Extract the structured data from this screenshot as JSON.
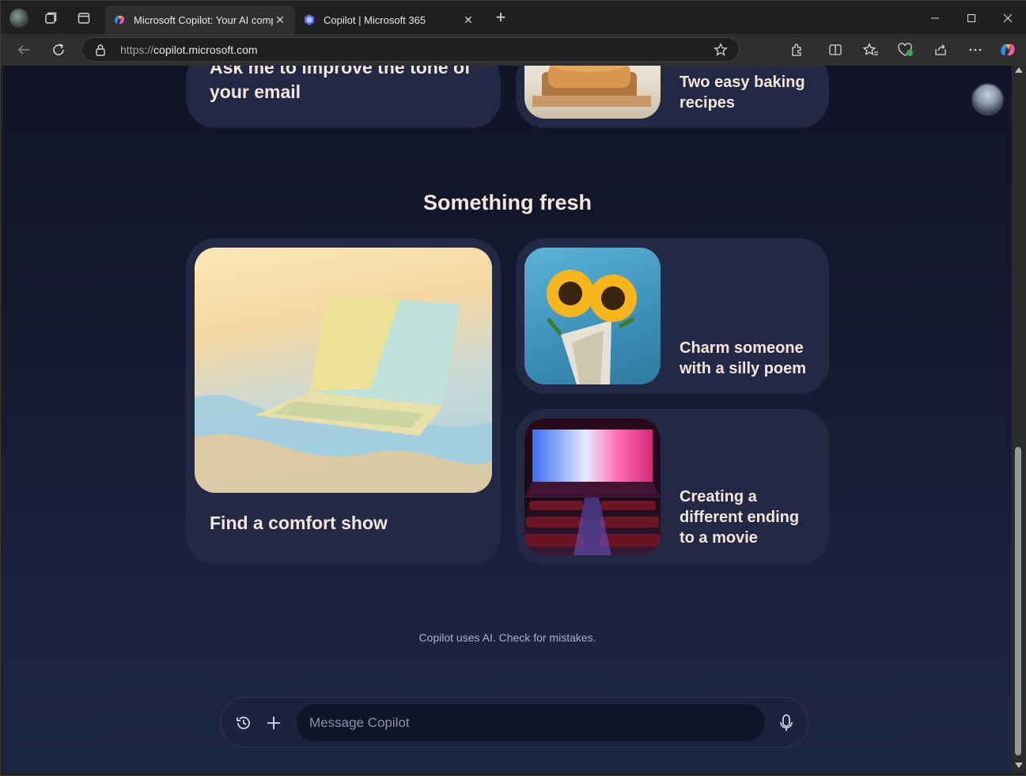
{
  "browser": {
    "tabs": [
      {
        "title": "Microsoft Copilot: Your AI compan",
        "active": true
      },
      {
        "title": "Copilot | Microsoft 365",
        "active": false
      }
    ],
    "address": {
      "protocol": "https://",
      "host": "copilot.microsoft.com"
    },
    "icons": [
      "profile-icon",
      "workspaces-icon",
      "tab-actions-icon",
      "back-icon",
      "refresh-icon",
      "lock-icon",
      "favorite-star-icon",
      "extensions-icon",
      "split-screen-icon",
      "favorites-icon",
      "browser-essentials-icon",
      "share-icon",
      "more-icon",
      "copilot-icon",
      "minimize-icon",
      "maximize-icon",
      "close-icon"
    ]
  },
  "page": {
    "top_cards": [
      {
        "label": "Ask me to improve the tone of your email"
      },
      {
        "label": "Two easy baking recipes"
      }
    ],
    "section_heading": "Something fresh",
    "fresh_cards": [
      {
        "label": "Find a comfort show",
        "image": "laptop-on-blanket"
      },
      {
        "label": "Charm someone with a silly poem",
        "image": "sunflowers"
      },
      {
        "label": "Creating a different ending to a movie",
        "image": "movie-theater"
      }
    ],
    "disclaimer": "Copilot uses AI. Check for mistakes.",
    "composer": {
      "placeholder": "Message Copilot"
    }
  },
  "colors": {
    "page_bg_top": "#111426",
    "page_bg_bottom": "#1e2646",
    "card_bg": "#232845",
    "card_text": "#f4e6dc"
  }
}
